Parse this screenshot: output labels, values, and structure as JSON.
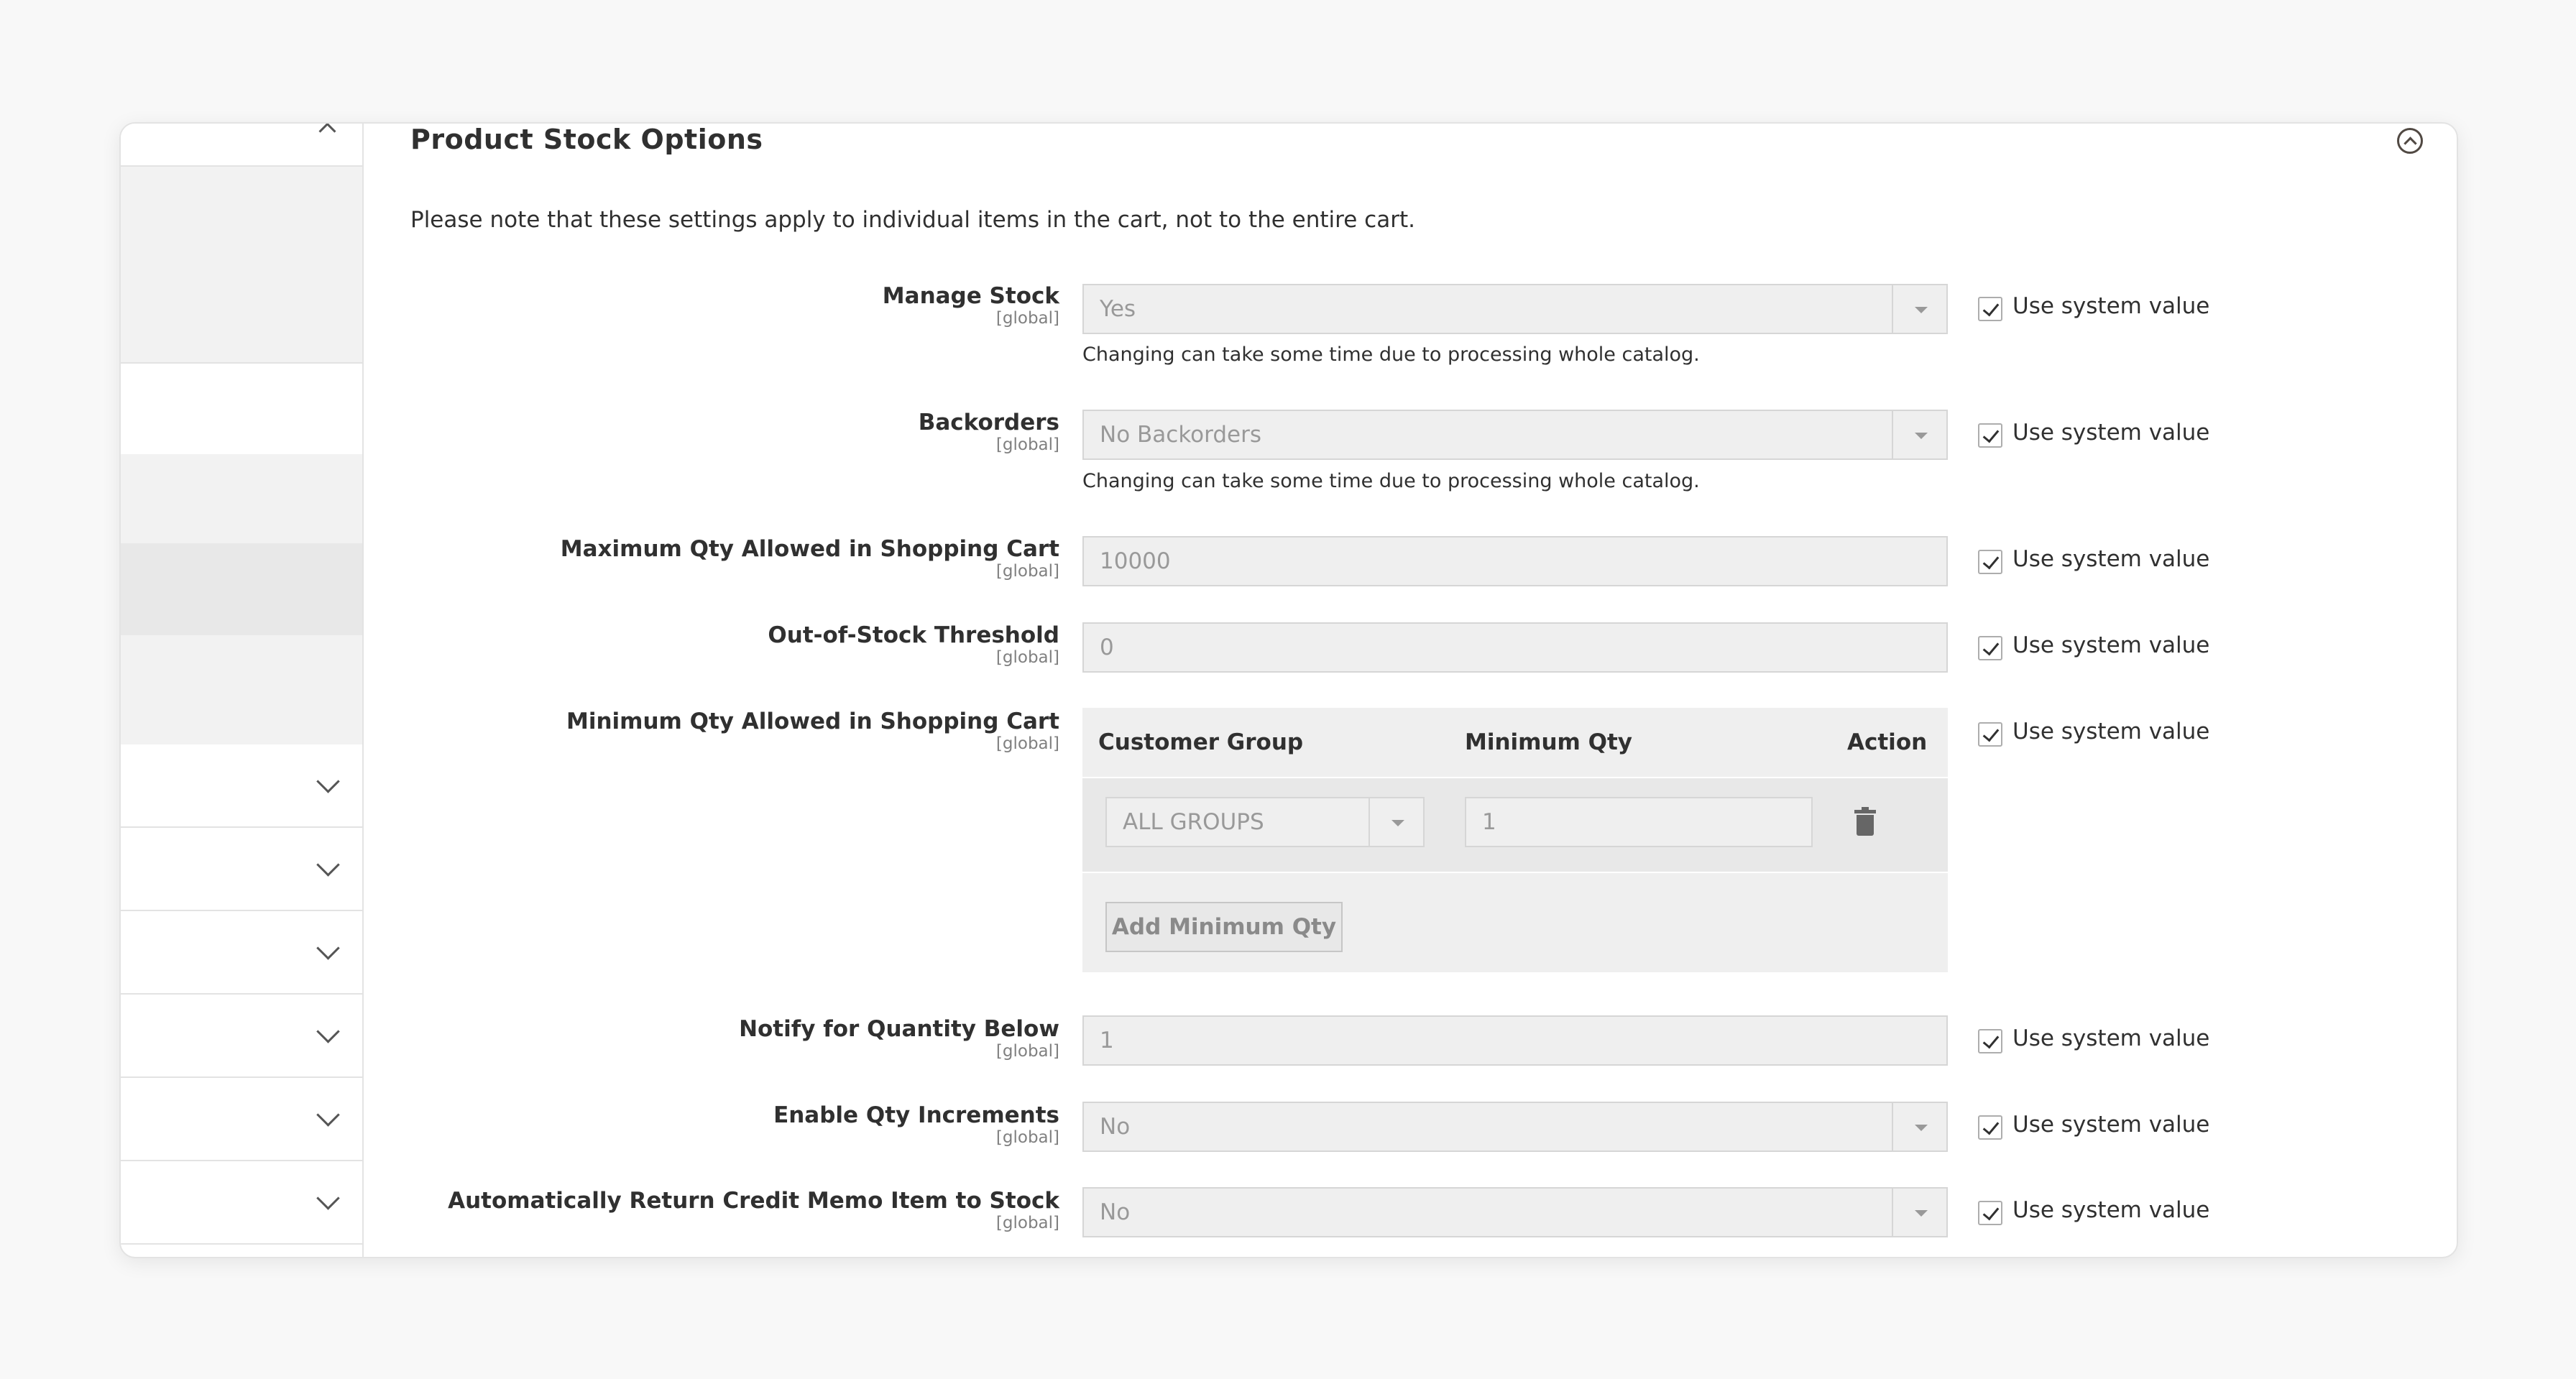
{
  "section": {
    "title": "Product Stock Options",
    "note": "Please note that these settings apply to individual items in the cart, not to the entire cart."
  },
  "common": {
    "scope": "[global]",
    "use_system": "Use system value"
  },
  "fields": {
    "manage_stock": {
      "label": "Manage Stock",
      "value": "Yes",
      "hint": "Changing can take some time due to processing whole catalog."
    },
    "backorders": {
      "label": "Backorders",
      "value": "No Backorders",
      "hint": "Changing can take some time due to processing whole catalog."
    },
    "max_qty": {
      "label": "Maximum Qty Allowed in Shopping Cart",
      "value": "10000"
    },
    "oos_threshold": {
      "label": "Out-of-Stock Threshold",
      "value": "0"
    },
    "min_qty": {
      "label": "Minimum Qty Allowed in Shopping Cart",
      "col_group": "Customer Group",
      "col_qty": "Minimum Qty",
      "col_action": "Action",
      "row_group": "ALL GROUPS",
      "row_qty": "1",
      "add_label": "Add Minimum Qty"
    },
    "notify_below": {
      "label": "Notify for Quantity Below",
      "value": "1"
    },
    "qty_increments": {
      "label": "Enable Qty Increments",
      "value": "No"
    },
    "auto_return": {
      "label": "Automatically Return Credit Memo Item to Stock",
      "value": "No"
    }
  }
}
